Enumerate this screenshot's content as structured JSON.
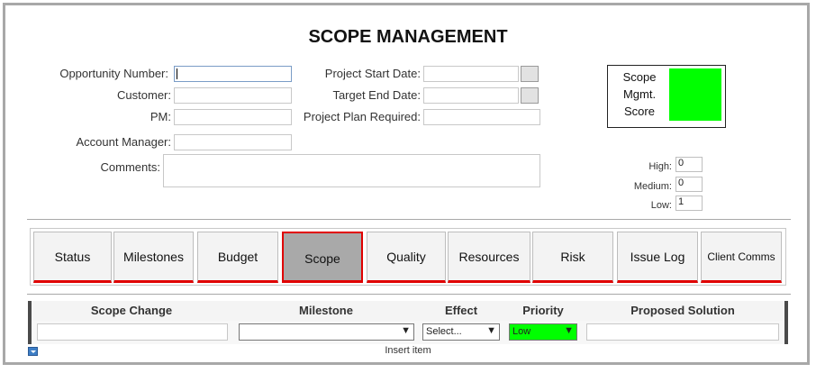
{
  "title": "SCOPE MANAGEMENT",
  "form": {
    "opportunity_number": {
      "label": "Opportunity Number:",
      "value": ""
    },
    "customer": {
      "label": "Customer:",
      "value": ""
    },
    "pm": {
      "label": "PM:",
      "value": ""
    },
    "account_manager": {
      "label": "Account Manager:",
      "value": ""
    },
    "comments": {
      "label": "Comments:",
      "value": ""
    },
    "project_start_date": {
      "label": "Project Start Date:",
      "value": ""
    },
    "target_end_date": {
      "label": "Target End Date:",
      "value": ""
    },
    "project_plan_required": {
      "label": "Project Plan Required:",
      "value": ""
    }
  },
  "score": {
    "label_line1": "Scope",
    "label_line2": "Mgmt.",
    "label_line3": "Score",
    "swatch_color": "#00ff00"
  },
  "counts": {
    "high": {
      "label": "High:",
      "value": "0"
    },
    "medium": {
      "label": "Medium:",
      "value": "0"
    },
    "low": {
      "label": "Low:",
      "value": "1"
    }
  },
  "tabs": [
    {
      "label": "Status"
    },
    {
      "label": "Milestones"
    },
    {
      "label": "Budget"
    },
    {
      "label": "Scope",
      "active": true
    },
    {
      "label": "Quality"
    },
    {
      "label": "Resources"
    },
    {
      "label": "Risk"
    },
    {
      "label": "Issue Log"
    },
    {
      "label": "Client Comms"
    }
  ],
  "grid": {
    "columns": [
      "Scope Change",
      "Milestone",
      "Effect",
      "Priority",
      "Proposed Solution"
    ],
    "row": {
      "scope_change": "",
      "milestone": "",
      "effect": "Select...",
      "priority": "Low",
      "proposed_solution": ""
    },
    "insert_label": "Insert item"
  },
  "colors": {
    "accent_red": "#e00000",
    "score_green": "#00ff00",
    "active_tab_bg": "#a9a9a9"
  }
}
